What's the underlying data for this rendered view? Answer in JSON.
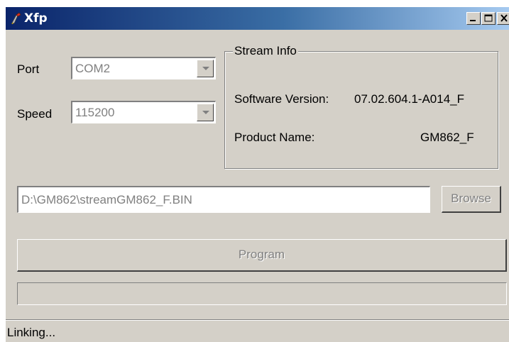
{
  "window": {
    "title": "Xfp",
    "controls": {
      "minimize_icon": "minimize-icon",
      "maximize_icon": "maximize-icon",
      "close_icon": "close-icon"
    }
  },
  "port": {
    "label": "Port",
    "value": "COM2"
  },
  "speed": {
    "label": "Speed",
    "value": "115200"
  },
  "stream_info": {
    "title": "Stream Info",
    "software_version_label": "Software Version:",
    "software_version_value": "07.02.604.1-A014_F",
    "product_name_label": "Product Name:",
    "product_name_value": "GM862_F"
  },
  "file": {
    "path": "D:\\GM862\\streamGM862_F.BIN",
    "browse_label": "Browse"
  },
  "program": {
    "label": "Program",
    "progress": 0
  },
  "status": {
    "text": "Linking..."
  },
  "colors": {
    "face": "#d4d0c8",
    "title_start": "#0a246a",
    "title_end": "#a6caf0",
    "disabled_text": "#808080"
  }
}
